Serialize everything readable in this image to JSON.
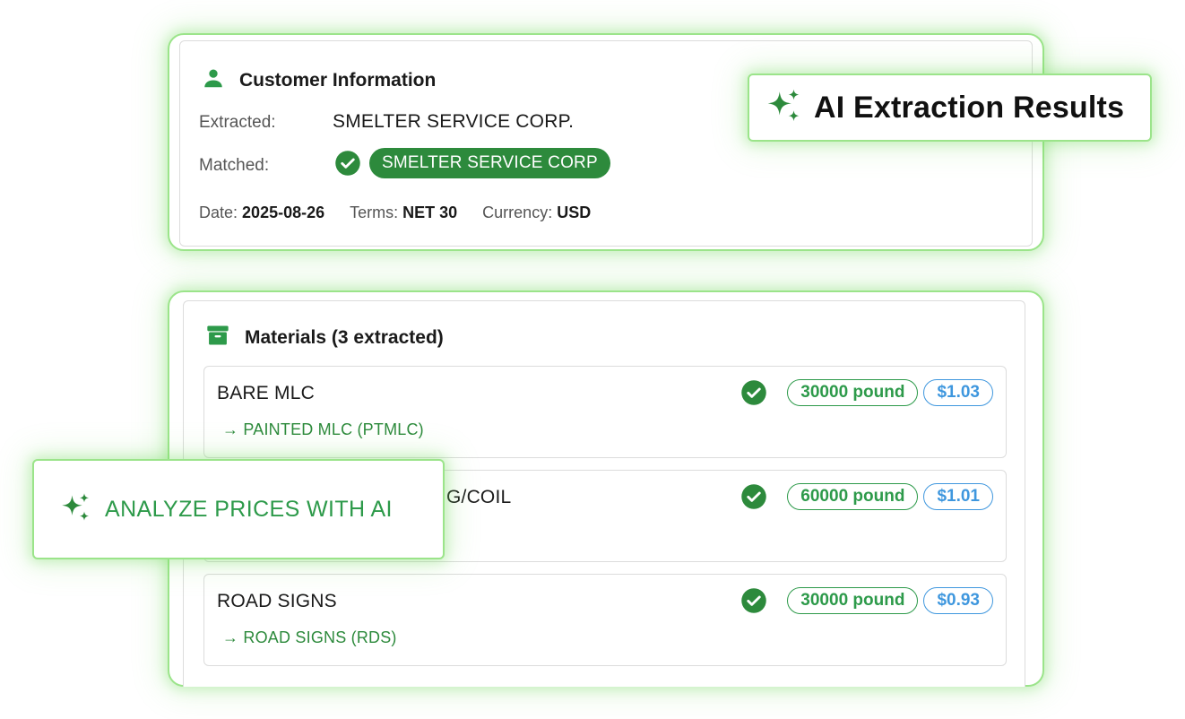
{
  "customer": {
    "title": "Customer Information",
    "extracted_label": "Extracted:",
    "extracted_value": "SMELTER SERVICE CORP.",
    "matched_label": "Matched:",
    "matched_value": "SMELTER SERVICE CORP",
    "date_label": "Date:",
    "date_value": "2025-08-26",
    "terms_label": "Terms:",
    "terms_value": "NET 30",
    "currency_label": "Currency:",
    "currency_value": "USD"
  },
  "ai_results": {
    "label": "AI Extraction Results"
  },
  "materials": {
    "title": "Materials (3 extracted)",
    "items": [
      {
        "name": "BARE MLC",
        "match": "→ PAINTED MLC (PTMLC)",
        "quantity": "30000 pound",
        "price": "$1.03"
      },
      {
        "name": "G/COIL",
        "match": "",
        "quantity": "60000 pound",
        "price": "$1.01"
      },
      {
        "name": "ROAD SIGNS",
        "match": "→ ROAD SIGNS (RDS)",
        "quantity": "30000 pound",
        "price": "$0.93"
      }
    ]
  },
  "analyze": {
    "label": "ANALYZE PRICES WITH AI"
  },
  "colors": {
    "accent_green": "#2d9a4a",
    "matched_green": "#2d8a3c",
    "price_blue": "#3f97de",
    "glow_green": "#9be48a"
  },
  "icons": [
    "person-icon",
    "sparkle-icon",
    "check-circle-icon",
    "archive-icon"
  ]
}
